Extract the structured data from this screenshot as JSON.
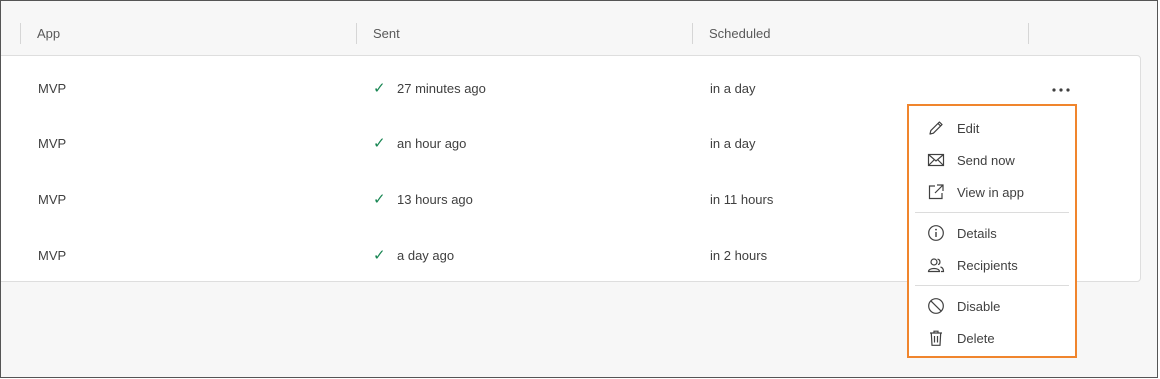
{
  "table": {
    "columns": [
      "App",
      "Sent",
      "Scheduled"
    ],
    "rows": [
      {
        "app": "MVP",
        "sent": "27 minutes ago",
        "scheduled": "in a day"
      },
      {
        "app": "MVP",
        "sent": "an hour ago",
        "scheduled": "in a day"
      },
      {
        "app": "MVP",
        "sent": "13 hours ago",
        "scheduled": "in 11 hours"
      },
      {
        "app": "MVP",
        "sent": "a day ago",
        "scheduled": "in 2 hours"
      }
    ],
    "sent_status_icon": "checkmark-icon",
    "sent_status_color": "#1a8754",
    "row_actions_icon": "more-horizontal-icon"
  },
  "menu": {
    "highlight_color": "#f0852d",
    "items": [
      {
        "label": "Edit",
        "icon": "pencil-icon"
      },
      {
        "label": "Send now",
        "icon": "envelope-icon"
      },
      {
        "label": "View in app",
        "icon": "external-link-icon"
      },
      {
        "label": "Details",
        "icon": "info-icon"
      },
      {
        "label": "Recipients",
        "icon": "users-icon"
      },
      {
        "label": "Disable",
        "icon": "disable-icon"
      },
      {
        "label": "Delete",
        "icon": "trash-icon"
      }
    ]
  }
}
